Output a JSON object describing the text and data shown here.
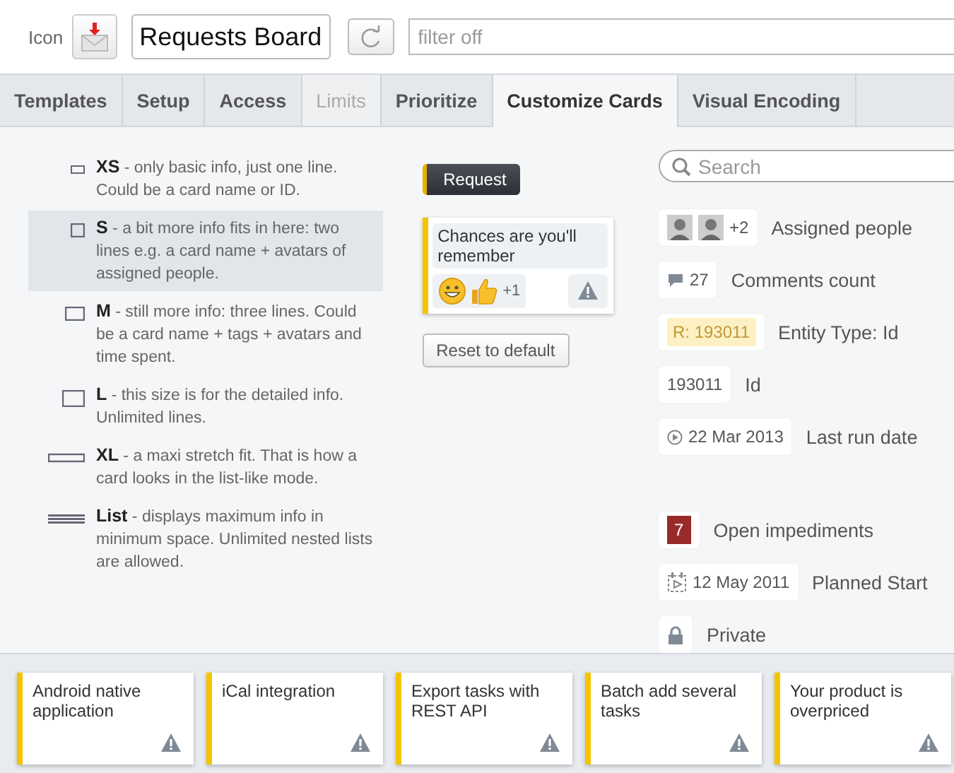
{
  "header": {
    "icon_label": "Icon",
    "board_name": "Requests Board",
    "filter": {
      "placeholder": "filter off"
    }
  },
  "tabs": [
    {
      "label": "Templates",
      "selected": false,
      "disabled": false
    },
    {
      "label": "Setup",
      "selected": false,
      "disabled": false
    },
    {
      "label": "Access",
      "selected": false,
      "disabled": false
    },
    {
      "label": "Limits",
      "selected": false,
      "disabled": true
    },
    {
      "label": "Prioritize",
      "selected": false,
      "disabled": false
    },
    {
      "label": "Customize Cards",
      "selected": true,
      "disabled": false
    },
    {
      "label": "Visual Encoding",
      "selected": false,
      "disabled": false
    }
  ],
  "sizes": [
    {
      "kind": "xs",
      "text": "**XS** - only basic info, just one line. Could be a card name or ID.",
      "selected": false
    },
    {
      "kind": "s",
      "text": "**S** - a bit more info fits in here: two lines e.g. a card name + avatars of assigned people.",
      "selected": true
    },
    {
      "kind": "m",
      "text": "**M** - still more info: three lines. Could be a card name + tags + avatars and time spent.",
      "selected": false
    },
    {
      "kind": "l",
      "text": "**L** - this size is for the detailed info. Unlimited lines.",
      "selected": false
    },
    {
      "kind": "xl",
      "text": "**XL** - a maxi stretch fit. That is how a card looks in the list-like mode.",
      "selected": false
    },
    {
      "kind": "list",
      "text": "**List** - displays maximum info in minimum space. Unlimited nested lists are allowed.",
      "selected": false
    }
  ],
  "preview": {
    "type_badge": "Request",
    "card_title": "Chances are you'll remember",
    "reaction_count": "+1",
    "reset_button": "Reset to default"
  },
  "fields": {
    "search": {
      "placeholder": "Search"
    },
    "items": [
      {
        "kind": "avatars",
        "value": "+2",
        "label": "Assigned people"
      },
      {
        "kind": "comments",
        "value": "27",
        "label": "Comments count"
      },
      {
        "kind": "entity",
        "value": "R: 193011",
        "label": "Entity Type: Id"
      },
      {
        "kind": "id",
        "value": "193011",
        "label": "Id"
      },
      {
        "kind": "run-date",
        "value": "22 Mar 2013",
        "label": "Last run date"
      },
      {
        "kind": "impediments",
        "value": "7",
        "label": "Open impediments"
      },
      {
        "kind": "planned",
        "value": "12 May 2011",
        "label": "Planned Start"
      },
      {
        "kind": "private",
        "label": "Private"
      }
    ]
  },
  "tray": [
    {
      "title": "Android native application"
    },
    {
      "title": "iCal integration"
    },
    {
      "title": "Export tasks with REST API"
    },
    {
      "title": "Batch add several tasks"
    },
    {
      "title": "Your product is overpriced"
    }
  ]
}
